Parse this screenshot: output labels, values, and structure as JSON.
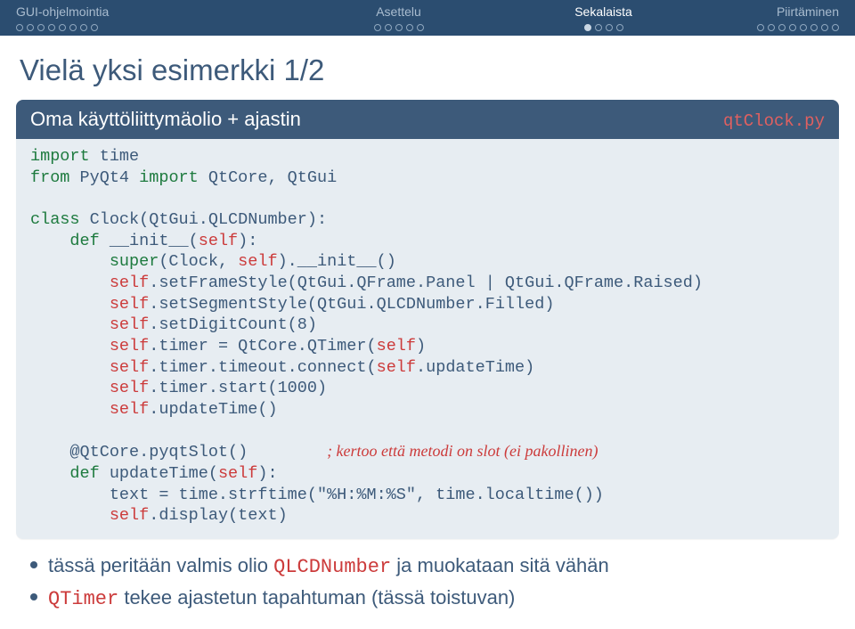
{
  "nav": {
    "items": [
      {
        "label": "GUI-ohjelmointia",
        "active": false,
        "dots": [
          0,
          0,
          0,
          0,
          0,
          0,
          0,
          0
        ]
      },
      {
        "label": "Asettelu",
        "active": false,
        "dots": [
          0,
          0,
          0,
          0,
          0
        ]
      },
      {
        "label": "Sekalaista",
        "active": true,
        "dots": [
          1,
          0,
          0,
          0
        ]
      },
      {
        "label": "Piirtäminen",
        "active": false,
        "dots": [
          0,
          0,
          0,
          0,
          0,
          0,
          0,
          0
        ]
      }
    ]
  },
  "title": "Vielä yksi esimerkki 1/2",
  "block": {
    "header": "Oma käyttöliittymäolio + ajastin",
    "filename": "qtClock.py",
    "code": {
      "l1a": "import",
      "l1b": " time",
      "l2a": "from",
      "l2b": " PyQt4 ",
      "l2c": "import",
      "l2d": " QtCore, QtGui",
      "l3a": "class",
      "l3b": " Clock(QtGui.QLCDNumber):",
      "l4a": "    def",
      "l4b": " __init__(",
      "l4c": "self",
      "l4d": "):",
      "l5a": "        super",
      "l5b": "(Clock, ",
      "l5c": "self",
      "l5d": ").__init__()",
      "l6a": "        ",
      "l6b": "self",
      "l6c": ".setFrameStyle(QtGui.QFrame.Panel | QtGui.QFrame.Raised)",
      "l7a": "        ",
      "l7b": "self",
      "l7c": ".setSegmentStyle(QtGui.QLCDNumber.Filled)",
      "l8a": "        ",
      "l8b": "self",
      "l8c": ".setDigitCount(8)",
      "l9a": "        ",
      "l9b": "self",
      "l9c": ".timer = QtCore.QTimer(",
      "l9d": "self",
      "l9e": ")",
      "l10a": "        ",
      "l10b": "self",
      "l10c": ".timer.timeout.connect(",
      "l10d": "self",
      "l10e": ".updateTime)",
      "l11a": "        ",
      "l11b": "self",
      "l11c": ".timer.start(1000)",
      "l12a": "        ",
      "l12b": "self",
      "l12c": ".updateTime()",
      "l13a": "    @QtCore.pyqtSlot()        ",
      "l13b": "; kertoo että metodi on slot (ei pakollinen)",
      "l14a": "    def",
      "l14b": " updateTime(",
      "l14c": "self",
      "l14d": "):",
      "l15": "        text = time.strftime(\"%H:%M:%S\", time.localtime())",
      "l16a": "        ",
      "l16b": "self",
      "l16c": ".display(text)"
    }
  },
  "bullets": {
    "b1a": "tässä peritään valmis olio ",
    "b1b": "QLCDNumber",
    "b1c": " ja muokataan sitä vähän",
    "b2a": "QTimer",
    "b2b": " tekee ajastetun tapahtuman (tässä toistuvan)"
  }
}
